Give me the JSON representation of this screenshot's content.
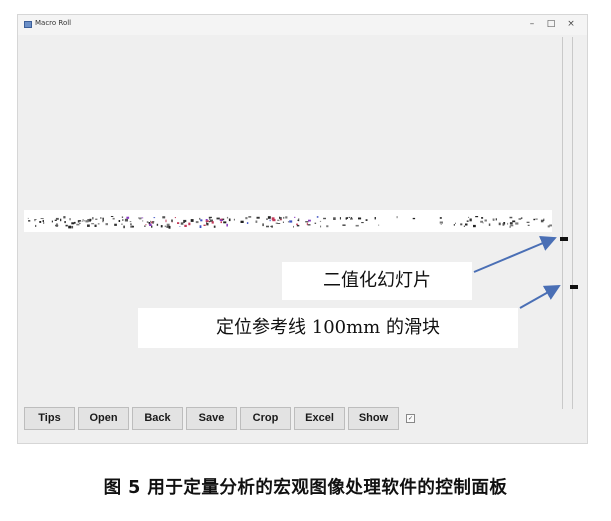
{
  "window": {
    "title": "Macro Roll",
    "controls": {
      "minimize": "–",
      "maximize": "□",
      "close": "×"
    }
  },
  "canvas": {
    "icons": [
      "binarized-slide-strip",
      "slider-handle"
    ]
  },
  "annotations": {
    "slide_label": "二值化幻灯片",
    "slider_label": "定位参考线 100mm 的滑块",
    "arrow_color": "#4a6fb5"
  },
  "toolbar": {
    "buttons": [
      "Tips",
      "Open",
      "Back",
      "Save",
      "Crop",
      "Excel",
      "Show"
    ]
  },
  "caption": "图 5  用于定量分析的宏观图像处理软件的控制面板"
}
